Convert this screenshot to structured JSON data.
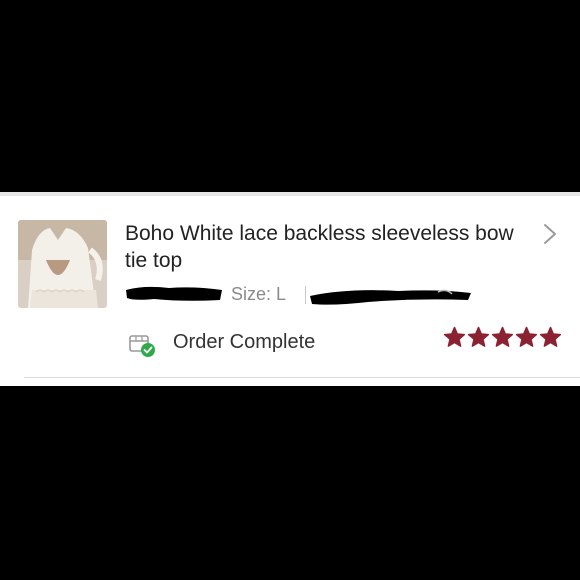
{
  "order_item": {
    "title": "Boho White lace backless sleeveless bow tie top",
    "size": "Size: L",
    "status": "Order Complete",
    "rating": 5,
    "rating_max": 5,
    "colors": {
      "star": "#8b2232",
      "check": "#2eaa4a",
      "title": "#222222",
      "meta": "#888888"
    },
    "icons": [
      "chevron-right-icon",
      "package-check-icon",
      "star-icon"
    ]
  }
}
